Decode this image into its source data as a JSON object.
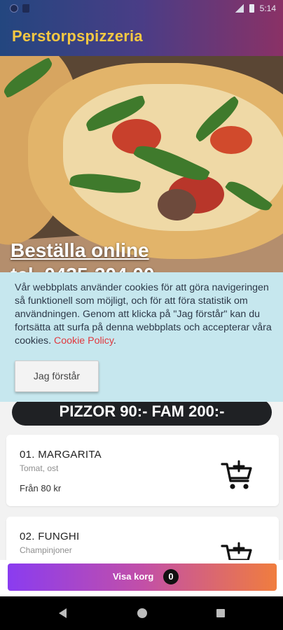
{
  "status_bar": {
    "time": "5:14",
    "icons": [
      "notification-dot-icon",
      "sd-card-icon",
      "signal-icon",
      "battery-icon"
    ]
  },
  "app": {
    "title": "Perstorpspizzeria",
    "title_color": "#f5c842"
  },
  "hero": {
    "headline": "Beställa online",
    "phone": "tel. 0435-204 00"
  },
  "cookie_banner": {
    "text": "Vår webbplats använder cookies för att göra navigeringen så funktionell som möjligt, och för att föra statistik om användningen. Genom att klicka på \"Jag förstår\" kan du fortsätta att surfa på denna webbplats och accepterar våra cookies.",
    "policy_link": "Cookie Policy",
    "trailing": ".",
    "accept_label": "Jag förstår"
  },
  "section": {
    "title": "PIZZOR 90:- FAM 200:-"
  },
  "menu_items": [
    {
      "name": "01. MARGARITA",
      "description": "Tomat, ost",
      "price": "Från 80 kr",
      "icon": "add-to-cart-icon"
    },
    {
      "name": "02. FUNGHI",
      "description": "Champinjoner",
      "price": "",
      "icon": "add-to-cart-icon"
    }
  ],
  "cart": {
    "label": "Visa korg",
    "count": "0"
  },
  "nav": {
    "icons": [
      "back-icon",
      "home-icon",
      "recents-icon"
    ]
  }
}
